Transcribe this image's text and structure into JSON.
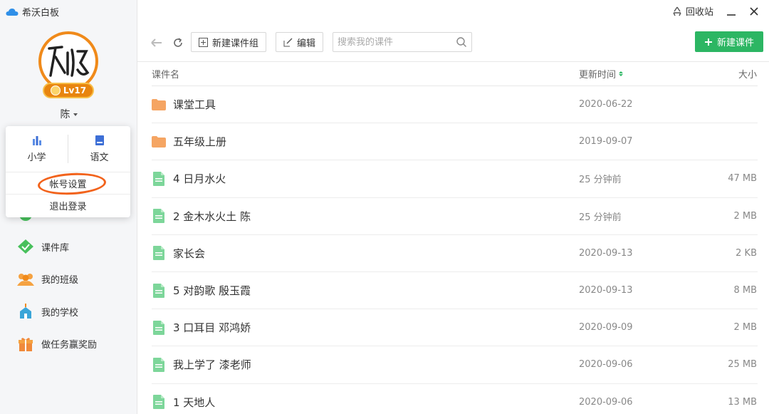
{
  "app": {
    "title": "希沃白板",
    "brand_color": "#2f8fe8"
  },
  "window": {
    "recycle_label": "回收站",
    "minimize_icon": "minimize-icon",
    "close_icon": "close-icon"
  },
  "profile": {
    "level": "Lv17",
    "name": "陈"
  },
  "popup": {
    "grade": "小学",
    "subject": "语文",
    "account_settings": "帐号设置",
    "logout": "退出登录",
    "highlight_color": "#f2631c"
  },
  "nav": [
    {
      "label": "课件库",
      "icon": "diamond-icon",
      "color": "#48c05c"
    },
    {
      "label": "我的班级",
      "icon": "group-icon",
      "color": "#f5a241"
    },
    {
      "label": "我的学校",
      "icon": "school-icon",
      "color": "#3aa5d8"
    },
    {
      "label": "做任务赢奖励",
      "icon": "gift-icon",
      "color": "#f08a3a"
    }
  ],
  "toolbar": {
    "new_group": "新建课件组",
    "edit": "编辑",
    "search_placeholder": "搜索我的课件",
    "new_courseware": "新建课件",
    "accent_color": "#2cb663"
  },
  "table": {
    "headers": {
      "name": "课件名",
      "updated": "更新时间",
      "size": "大小"
    },
    "rows": [
      {
        "type": "folder",
        "name": "课堂工具",
        "date": "2020-06-22",
        "size": ""
      },
      {
        "type": "folder",
        "name": "五年级上册",
        "date": "2019-09-07",
        "size": ""
      },
      {
        "type": "file",
        "name": "4 日月水火",
        "date": "25 分钟前",
        "size": "47 MB"
      },
      {
        "type": "file",
        "name": "2 金木水火土 陈",
        "date": "25 分钟前",
        "size": "2 MB"
      },
      {
        "type": "file",
        "name": "家长会",
        "date": "2020-09-13",
        "size": "2 KB"
      },
      {
        "type": "file",
        "name": "5 对韵歌 殷玉霞",
        "date": "2020-09-13",
        "size": "8 MB"
      },
      {
        "type": "file",
        "name": "3 口耳目 邓鸿娇",
        "date": "2020-09-09",
        "size": "2 MB"
      },
      {
        "type": "file",
        "name": "我上学了 漆老师",
        "date": "2020-09-06",
        "size": "25 MB"
      },
      {
        "type": "file",
        "name": "1 天地人",
        "date": "2020-09-06",
        "size": "13 MB"
      }
    ]
  }
}
